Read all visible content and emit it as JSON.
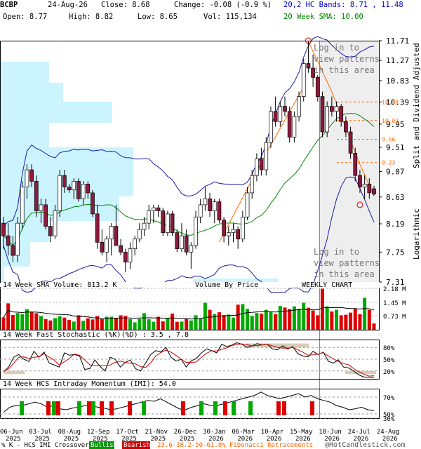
{
  "header": {
    "symbol": "BCBP",
    "date": "24-Aug-26",
    "close": "Close: 8.68",
    "change": "Change: -0.08 (-0.9 %)",
    "open": "Open: 8.77",
    "high": "High: 8.82",
    "low": "Low: 8.65",
    "vol": "Vol: 115,134",
    "bands": "20,2 HC Bands: 8.71 , 11.48",
    "sma": "20 Week SMA: 10.00"
  },
  "side_labels": {
    "right_top": "Split and Dividend Adjusted",
    "right_bottom": "Logarithmic"
  },
  "panel_titles": {
    "volume": "14 Week SMA Volume: 813.2 K",
    "vbp": "Volume By Price",
    "weekly": "WEEKLY CHART",
    "stoch": "14 Week Fast Stochastic (%K)(%D) : 3.5 , 7.8",
    "imi": "14 Week HCS Intraday Momentum (IMI): 54.0"
  },
  "patterns": {
    "top": [
      "Log in to",
      "view patterns",
      "in this area"
    ],
    "bottom": [
      "Log in to",
      "view patterns",
      "in this area"
    ]
  },
  "footer": {
    "legend": "% K - HCS IMI Crossover:",
    "bullish": "Bullish",
    "bearish": "Bearish",
    "fib": "23.6-38.2-50-61.8% Fibonacci Retracements",
    "copyright": "@HotCandlestick.com"
  },
  "colors": {
    "up": "#ffffff",
    "down": "#8b1a3c",
    "band": "#1a1aaa",
    "sma": "#008800",
    "fib": "#ff6600",
    "vbp": "#ccf4ff",
    "vol_up": "#00aa00",
    "vol_down": "#dd0000",
    "shade": "#eeeeee"
  },
  "chart_data": {
    "type": "candlestick",
    "scale": "log",
    "ylim": [
      7.31,
      11.71
    ],
    "yticks": [
      "11.71",
      "11.27",
      "10.83",
      "10.39",
      "9.95",
      "9.51",
      "9.07",
      "8.63",
      "8.19",
      "7.75",
      "7.31"
    ],
    "fib_levels": [
      "10.39",
      "10.02",
      "9.66",
      "9.23"
    ],
    "x_labels": [
      "06-Jun 2025",
      "03-Jul 2025",
      "08-Aug 2025",
      "12-Sep 2025",
      "17-Oct 2025",
      "21-Nov 2025",
      "26-Dec 2025",
      "30-Jan 2026",
      "06-Mar 2026",
      "10-Apr 2026",
      "15-May 2026",
      "18-Jun 2026",
      "24-Jul 2026",
      "24-Aug 2026"
    ],
    "candles": [
      [
        8.2,
        8.3,
        7.8,
        8.0
      ],
      [
        8.0,
        8.2,
        7.7,
        7.85
      ],
      [
        7.85,
        8.0,
        7.6,
        7.7
      ],
      [
        7.7,
        8.3,
        7.6,
        8.2
      ],
      [
        8.2,
        8.9,
        8.1,
        8.8
      ],
      [
        8.8,
        9.2,
        8.6,
        9.1
      ],
      [
        9.1,
        9.2,
        8.8,
        8.9
      ],
      [
        8.9,
        9.0,
        8.3,
        8.4
      ],
      [
        8.4,
        8.6,
        8.2,
        8.5
      ],
      [
        8.5,
        8.6,
        8.1,
        8.15
      ],
      [
        8.15,
        8.3,
        7.9,
        8.0
      ],
      [
        8.0,
        8.5,
        7.95,
        8.4
      ],
      [
        8.4,
        9.1,
        8.3,
        9.0
      ],
      [
        9.0,
        9.1,
        8.7,
        8.8
      ],
      [
        8.8,
        8.85,
        8.7,
        8.75
      ],
      [
        8.75,
        8.95,
        8.6,
        8.9
      ],
      [
        8.9,
        8.95,
        8.55,
        8.6
      ],
      [
        8.6,
        8.9,
        8.5,
        8.85
      ],
      [
        8.85,
        8.9,
        8.6,
        8.7
      ],
      [
        8.7,
        8.75,
        8.3,
        8.35
      ],
      [
        8.35,
        8.5,
        7.8,
        7.9
      ],
      [
        7.9,
        8.1,
        7.7,
        7.75
      ],
      [
        7.75,
        8.0,
        7.6,
        7.95
      ],
      [
        7.95,
        8.2,
        7.7,
        8.15
      ],
      [
        8.15,
        8.5,
        8.0,
        7.85
      ],
      [
        7.85,
        7.95,
        7.7,
        7.75
      ],
      [
        7.75,
        7.8,
        7.45,
        7.6
      ],
      [
        7.6,
        7.9,
        7.5,
        7.8
      ],
      [
        7.8,
        8.0,
        7.7,
        7.95
      ],
      [
        7.95,
        8.2,
        7.9,
        8.1
      ],
      [
        8.1,
        8.3,
        8.0,
        8.2
      ],
      [
        8.2,
        8.5,
        8.1,
        8.4
      ],
      [
        8.4,
        8.5,
        8.2,
        8.45
      ],
      [
        8.45,
        8.5,
        8.3,
        8.4
      ],
      [
        8.4,
        8.45,
        8.0,
        8.05
      ],
      [
        8.05,
        8.4,
        8.0,
        8.35
      ],
      [
        8.35,
        8.4,
        8.0,
        8.05
      ],
      [
        8.05,
        8.1,
        7.75,
        7.8
      ],
      [
        7.8,
        8.2,
        7.75,
        8.0
      ],
      [
        8.0,
        8.1,
        7.7,
        7.75
      ],
      [
        7.75,
        7.9,
        7.5,
        7.85
      ],
      [
        7.85,
        8.4,
        7.8,
        8.3
      ],
      [
        8.3,
        8.6,
        8.2,
        8.5
      ],
      [
        8.5,
        8.8,
        8.4,
        8.6
      ],
      [
        8.6,
        8.7,
        8.3,
        8.4
      ],
      [
        8.4,
        8.6,
        8.2,
        8.55
      ],
      [
        8.55,
        8.6,
        8.2,
        8.25
      ],
      [
        8.25,
        8.3,
        7.9,
        8.0
      ],
      [
        8.0,
        8.15,
        7.85,
        8.05
      ],
      [
        8.05,
        8.2,
        7.9,
        8.1
      ],
      [
        8.1,
        8.15,
        7.8,
        7.95
      ],
      [
        7.95,
        8.4,
        7.9,
        8.3
      ],
      [
        8.3,
        8.8,
        8.25,
        8.7
      ],
      [
        8.7,
        9.1,
        8.6,
        9.0
      ],
      [
        9.0,
        9.4,
        8.9,
        9.3
      ],
      [
        9.3,
        9.5,
        9.0,
        9.1
      ],
      [
        9.1,
        9.7,
        9.0,
        9.6
      ],
      [
        9.6,
        10.3,
        9.5,
        10.2
      ],
      [
        10.2,
        10.5,
        9.9,
        10.0
      ],
      [
        10.0,
        10.4,
        9.9,
        10.3
      ],
      [
        10.3,
        10.5,
        10.1,
        10.2
      ],
      [
        10.2,
        10.3,
        9.6,
        9.7
      ],
      [
        9.7,
        10.2,
        9.6,
        10.1
      ],
      [
        10.1,
        10.6,
        10.0,
        10.5
      ],
      [
        10.5,
        11.3,
        10.4,
        11.2
      ],
      [
        11.2,
        11.7,
        11.0,
        11.1
      ],
      [
        11.1,
        11.4,
        10.7,
        10.9
      ],
      [
        10.9,
        10.95,
        10.4,
        10.5
      ],
      [
        10.5,
        10.6,
        9.7,
        9.8
      ],
      [
        9.8,
        10.4,
        9.7,
        10.3
      ],
      [
        10.3,
        10.5,
        10.1,
        10.2
      ],
      [
        10.2,
        10.4,
        10.0,
        10.3
      ],
      [
        10.3,
        10.35,
        9.9,
        10.0
      ],
      [
        10.0,
        10.1,
        9.7,
        9.8
      ],
      [
        9.8,
        9.9,
        9.3,
        9.4
      ],
      [
        9.4,
        9.5,
        8.9,
        9.0
      ],
      [
        9.0,
        9.1,
        8.7,
        8.8
      ],
      [
        8.8,
        9.0,
        8.6,
        8.85
      ],
      [
        8.85,
        8.95,
        8.6,
        8.7
      ],
      [
        8.77,
        8.82,
        8.65,
        8.68
      ]
    ],
    "volume_k": [
      650,
      1390,
      780,
      880,
      820,
      1080,
      950,
      870,
      720,
      560,
      490,
      610,
      700,
      640,
      520,
      430,
      760,
      470,
      600,
      540,
      720,
      560,
      680,
      680,
      620,
      760,
      730,
      560,
      390,
      570,
      870,
      550,
      420,
      680,
      440,
      600,
      850,
      420,
      430,
      590,
      490,
      760,
      600,
      1420,
      1050,
      830,
      920,
      770,
      800,
      640,
      1320,
      1350,
      1100,
      720,
      880,
      850,
      1050,
      960,
      820,
      1250,
      1170,
      1090,
      1230,
      1100,
      1420,
      1160,
      1010,
      760,
      2160,
      1230,
      960,
      1050,
      760,
      790,
      900,
      1090,
      820,
      1680,
      1050,
      330
    ],
    "stoch_k": [
      18,
      30,
      55,
      62,
      50,
      44,
      70,
      55,
      68,
      40,
      35,
      30,
      66,
      60,
      62,
      58,
      24,
      26,
      48,
      32,
      20,
      55,
      50,
      30,
      42,
      48,
      26,
      20,
      40,
      62,
      72,
      68,
      80,
      55,
      45,
      50,
      30,
      46,
      52,
      66,
      76,
      72,
      66,
      88,
      82,
      86,
      92,
      88,
      80,
      84,
      90,
      86,
      88,
      76,
      74,
      84,
      76,
      82,
      64,
      58,
      56,
      70,
      62,
      68,
      45,
      40,
      48,
      30,
      28,
      20,
      10,
      5,
      4,
      3.5
    ],
    "stoch_d": [
      20,
      25,
      40,
      55,
      56,
      52,
      55,
      56,
      64,
      55,
      48,
      35,
      44,
      52,
      63,
      60,
      48,
      36,
      33,
      35,
      33,
      35,
      42,
      45,
      42,
      40,
      38,
      31,
      29,
      41,
      58,
      67,
      73,
      68,
      60,
      50,
      42,
      42,
      43,
      55,
      65,
      71,
      71,
      75,
      79,
      85,
      87,
      89,
      87,
      84,
      85,
      86,
      88,
      84,
      80,
      78,
      78,
      80,
      74,
      68,
      60,
      61,
      63,
      67,
      58,
      51,
      44,
      39,
      36,
      26,
      18,
      12,
      7,
      7.8
    ],
    "imi": [
      52,
      58,
      60,
      60,
      62,
      64,
      62,
      58,
      60,
      56,
      55,
      57,
      58,
      60,
      60,
      58,
      57,
      55,
      56,
      58,
      60,
      62,
      64,
      66,
      65,
      68,
      64,
      60,
      56,
      55,
      58,
      60,
      62,
      60,
      60,
      62,
      64,
      66,
      68,
      70,
      72,
      76,
      72,
      70,
      68,
      70,
      72,
      74,
      70,
      72,
      68,
      66,
      64,
      60,
      58,
      55,
      56,
      58,
      55,
      54
    ]
  }
}
